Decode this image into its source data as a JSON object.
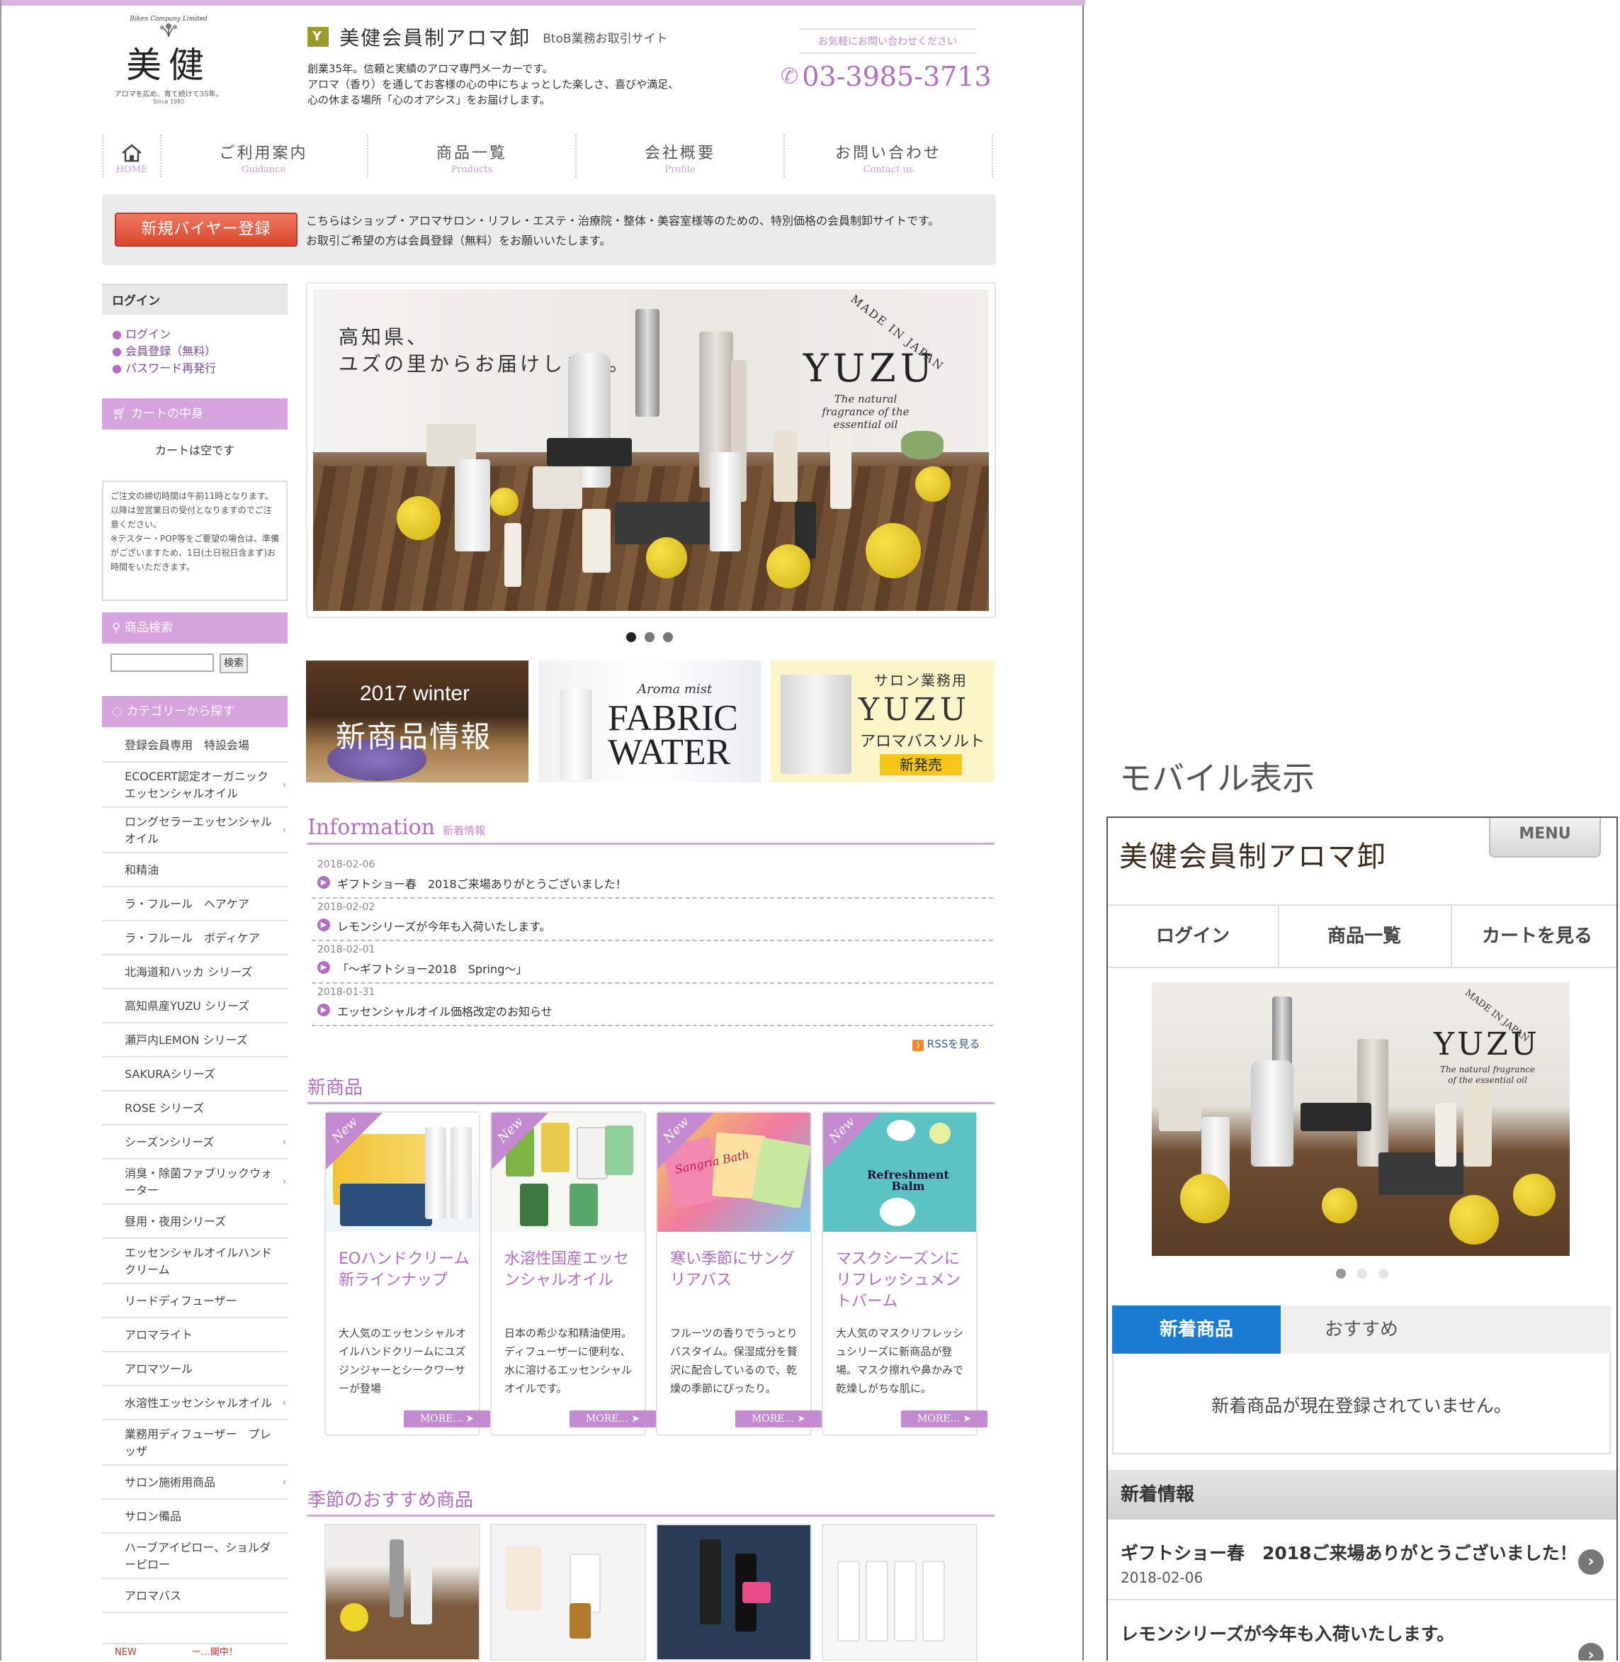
{
  "header": {
    "logo_text": "美健",
    "logo_arc": "Biken Company Limited",
    "logo_tagline": "アロマを広め、育て続けて35年。",
    "logo_since": "Since 1982",
    "site_title": "美健会員制アロマ卸",
    "site_subtitle": "BtoB業務お取引サイト",
    "intro_line1": "創業35年。信頼と実績のアロマ専門メーカーです。",
    "intro_line2": "アロマ（香り）を通してお客様の心の中にちょっとした楽しさ、喜びや満足、",
    "intro_line3": "心の休まる場所「心のオアシス」をお届けします。",
    "contact_note": "お気軽にお問い合わせください",
    "phone": "03-3985-3713"
  },
  "nav": [
    {
      "jp": "HOME",
      "en": ""
    },
    {
      "jp": "ご利用案内",
      "en": "Guidance"
    },
    {
      "jp": "商品一覧",
      "en": "Products"
    },
    {
      "jp": "会社概要",
      "en": "Profile"
    },
    {
      "jp": "お問い合わせ",
      "en": "Contact us"
    }
  ],
  "register": {
    "button": "新規バイヤー登録",
    "text1": "こちらはショップ・アロマサロン・リフレ・エステ・治療院・整体・美容室様等のための、特別価格の会員制卸サイトです。",
    "text2": "お取引ご希望の方は会員登録（無料）をお願いいたします。"
  },
  "sidebar": {
    "login_head": "ログイン",
    "login_links": [
      "ログイン",
      "会員登録（無料）",
      "パスワード再発行"
    ],
    "cart_head": "カートの中身",
    "cart_empty": "カートは空です",
    "notice": [
      "ご注文の締切時間は午前11時となります。",
      "以降は翌営業日の受付となりますのでご注意ください。",
      "※テスター・POP等をご要望の場合は、準備がございますため、1日(土日祝日含まず)お時間をいただきます。"
    ],
    "search_head": "商品検索",
    "search_button": "検索",
    "category_head": "カテゴリーから探す",
    "categories": [
      "登録会員専用　特設会場",
      "ECOCERT認定オーガニックエッセンシャルオイル",
      "ロングセラーエッセンシャルオイル",
      "和精油",
      "ラ・フルール　ヘアケア",
      "ラ・フルール　ボディケア",
      "北海道和ハッカ シリーズ",
      "高知県産YUZU シリーズ",
      "瀬戸内LEMON シリーズ",
      "SAKURAシリーズ",
      "ROSE シリーズ",
      "シーズンシリーズ",
      "消臭・除菌ファブリックウォーター",
      "昼用・夜用シリーズ",
      "エッセンシャルオイルハンドクリーム",
      "リードディフューザー",
      "アロマライト",
      "アロマツール",
      "水溶性エッセンシャルオイル",
      "業務用ディフューザー　プレッザ",
      "サロン施術用商品",
      "サロン備品",
      "ハーブアイピロー、ショルダーピロー",
      "アロマバス"
    ],
    "last_partial": "NEW　　　　　　ー…開中！"
  },
  "hero": {
    "line1": "高知県、",
    "line2": "ユズの里からお届けします。",
    "brand": "YUZU",
    "made_in": "MADE IN JAPAN",
    "tagline": "The natural fragrance of the essential oil"
  },
  "banners": {
    "b1_line1": "2017 winter",
    "b1_line2": "新商品情報",
    "b2_small": "Aroma mist",
    "b2_big1": "FABRIC",
    "b2_big2": "WATER",
    "b3_line1": "サロン業務用",
    "b3_line2": "YUZU",
    "b3_line3": "アロマバスソルト",
    "b3_line4": "新発売"
  },
  "information": {
    "title": "Information",
    "subtitle": "新着情報",
    "items": [
      {
        "date": "2018-02-06",
        "title": "ギフトショー春　2018ご来場ありがとうございました！"
      },
      {
        "date": "2018-02-02",
        "title": "レモンシリーズが今年も入荷いたします。"
      },
      {
        "date": "2018-02-01",
        "title": "「～ギフトショー2018　Spring～」"
      },
      {
        "date": "2018-01-31",
        "title": "エッセンシャルオイル価格改定のお知らせ"
      }
    ],
    "rss": "RSSを見る"
  },
  "new_products": {
    "title": "新商品",
    "tag": "New",
    "more": "MORE...",
    "items": [
      {
        "title": "EOハンドクリーム新ラインナップ",
        "desc": "大人気のエッセンシャルオイルハンドクリームにユズジンジャーとシークワーサーが登場"
      },
      {
        "title": "水溶性国産エッセンシャルオイル",
        "desc": "日本の希少な和精油使用。ディフューザーに便利な、水に溶けるエッセンシャルオイルです。"
      },
      {
        "title": "寒い季節にサングリアバス",
        "desc": "フルーツの香りでうっとりバスタイム。保湿成分を贅沢に配合しているので、乾燥の季節にぴったり。"
      },
      {
        "title": "マスクシーズンにリフレッシュメントバーム",
        "desc": "大人気のマスクリフレッシュシリーズに新商品が登場。マスク擦れや鼻かみで乾燥しがちな肌に。"
      }
    ],
    "img_texts": [
      "",
      "",
      "Sangria Bath",
      "Refreshment Balm"
    ]
  },
  "seasonal": {
    "title": "季節のおすすめ商品"
  },
  "mobile": {
    "label": "モバイル表示",
    "menu": "MENU",
    "title": "美健会員制アロマ卸",
    "tabs": [
      "ログイン",
      "商品一覧",
      "カートを見る"
    ],
    "hero_brand": "YUZU",
    "hero_made": "MADE IN JAPAN",
    "hero_tag": "The natural fragrance of the essential oil",
    "seg_active": "新着商品",
    "seg_other": "おすすめ",
    "empty": "新着商品が現在登録されていません。",
    "news_head": "新着情報",
    "news1_title": "ギフトショー春　2018ご来場ありがとうございました！",
    "news1_date": "2018-02-06",
    "news2_title": "レモンシリーズが今年も入荷いたします。"
  },
  "colors": {
    "accent": "#b36ec3",
    "sidebar_head": "#d7a3de",
    "register": "#e8604a",
    "mobile_tab": "#1a7bd2"
  }
}
